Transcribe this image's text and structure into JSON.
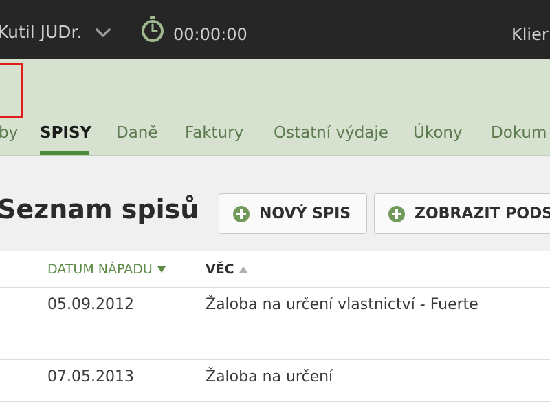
{
  "topbar": {
    "user_name": "Kutil JUDr.",
    "timer": "00:00:00",
    "clients_label": "Klier"
  },
  "nav": {
    "tabs": [
      {
        "label": "by",
        "active": false
      },
      {
        "label": "SPISY",
        "active": true
      },
      {
        "label": "Daně",
        "active": false
      },
      {
        "label": "Faktury",
        "active": false
      },
      {
        "label": "Ostatní výdaje",
        "active": false
      },
      {
        "label": "Úkony",
        "active": false
      },
      {
        "label": "Dokum",
        "active": false
      }
    ]
  },
  "main": {
    "title": "Seznam spisů",
    "new_button": "NOVÝ SPIS",
    "show_button": "ZOBRAZIT PODS"
  },
  "table": {
    "columns": [
      "DATUM NÁPADU",
      "VĚC"
    ],
    "rows": [
      {
        "date": "05.09.2012",
        "subject": "Žaloba na určení vlastnictví - Fuerte"
      },
      {
        "date": "07.05.2013",
        "subject": "Žaloba na určení"
      }
    ]
  },
  "colors": {
    "topbar_bg": "#262626",
    "nav_bg": "#d6e1cf",
    "accent_green": "#4f8a3c",
    "logo_frame": "#e01b1b"
  }
}
